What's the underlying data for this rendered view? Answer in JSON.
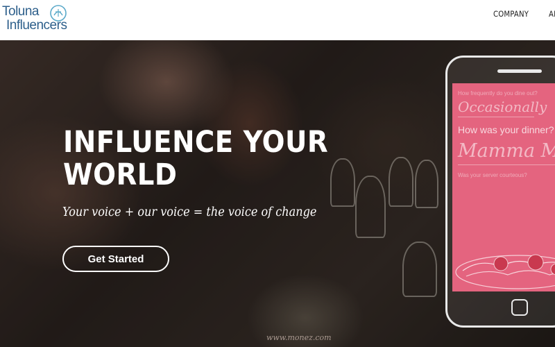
{
  "logo": {
    "line1": "Toluna",
    "line2": "Influencers"
  },
  "nav": {
    "items": [
      "COMPANY",
      "ABOU"
    ]
  },
  "hero": {
    "title": "INFLUENCE YOUR WORLD",
    "tagline": "Your voice + our voice = the voice of change",
    "cta_label": "Get Started"
  },
  "phone": {
    "q1": "How frequently do you dine out?",
    "a1": "Occasionally",
    "q2": "How was your dinner?",
    "a2": "Mamma Mia",
    "q3": "Was your server courteous?"
  },
  "watermark": "www.monez.com",
  "colors": {
    "brand_blue": "#2d5f8b",
    "phone_screen": "#e4647f",
    "hero_text": "#ffffff"
  }
}
